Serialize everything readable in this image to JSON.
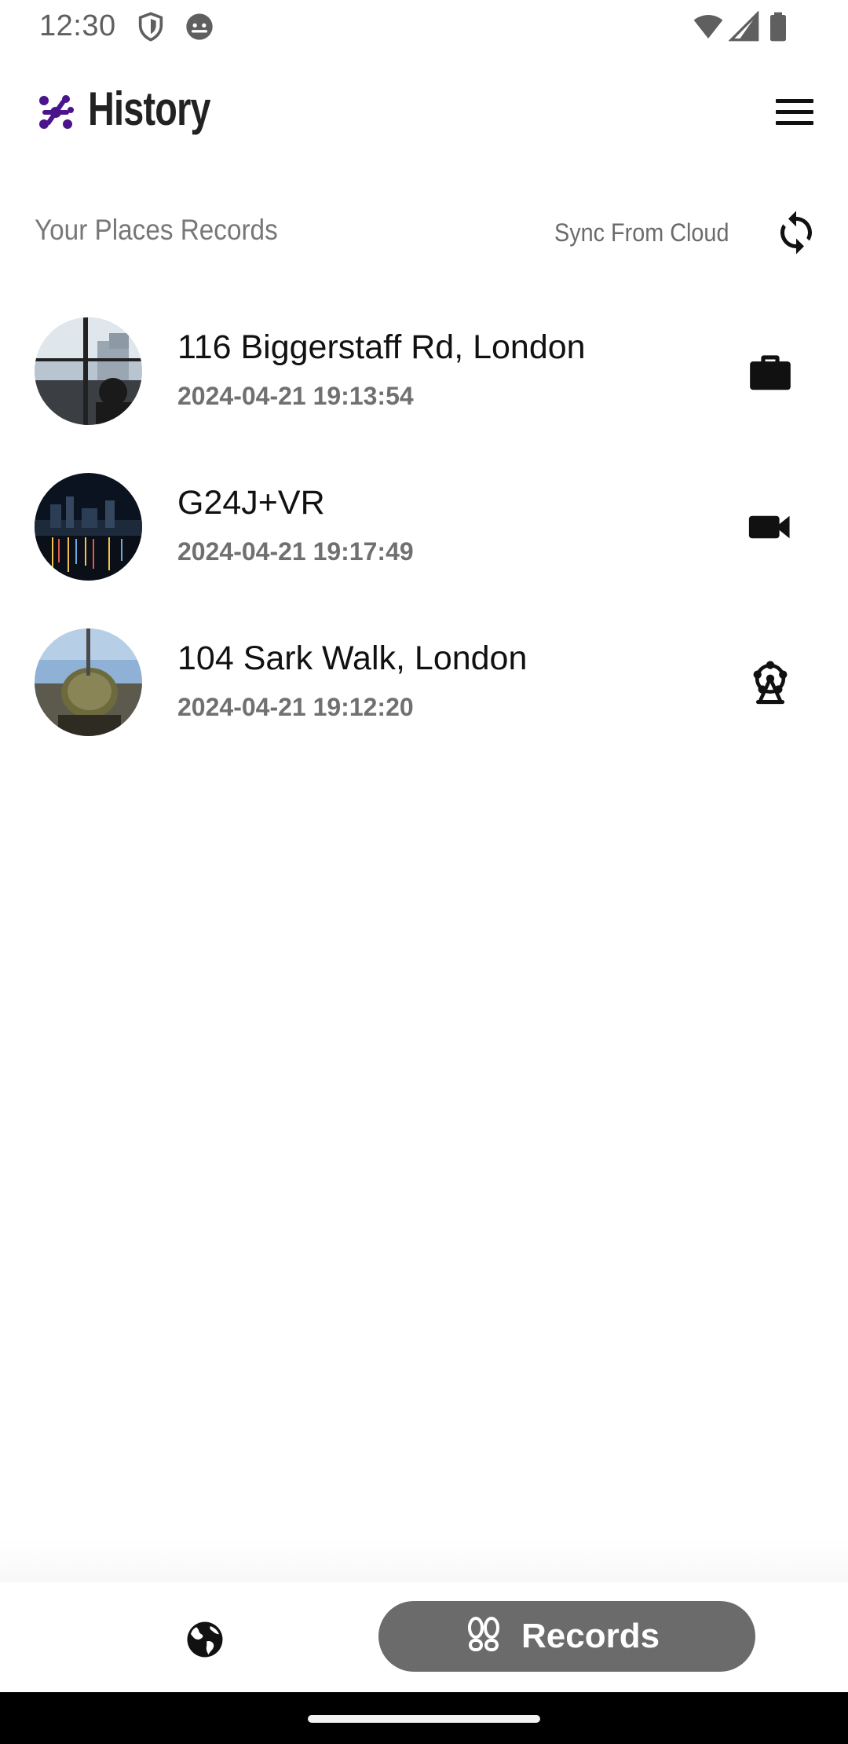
{
  "status_bar": {
    "time": "12:30",
    "left_icons": [
      "shield-icon",
      "android-icon"
    ],
    "right_icons": [
      "wifi-icon",
      "signal-icon",
      "battery-icon"
    ]
  },
  "app_bar": {
    "title": "History",
    "logo": "app-logo-icon",
    "menu_icon": "hamburger-menu-icon",
    "logo_color": "#4a148c"
  },
  "section": {
    "title": "Your Places Records",
    "sync_label": "Sync From Cloud",
    "sync_icon": "sync-icon"
  },
  "records": [
    {
      "title": "116 Biggerstaff Rd, London",
      "time": "2024-04-21 19:13:54",
      "category_icon": "briefcase-icon",
      "thumbnail": "office-window-photo"
    },
    {
      "title": "G24J+VR",
      "time": "2024-04-21 19:17:49",
      "category_icon": "videocam-icon",
      "thumbnail": "night-city-waterfront-photo"
    },
    {
      "title": "104 Sark Walk, London",
      "time": "2024-04-21 19:12:20",
      "category_icon": "ferris-wheel-icon",
      "thumbnail": "cactus-plant-photo"
    }
  ],
  "bottom_nav": {
    "globe_icon": "globe-icon",
    "records_label": "Records",
    "records_icon": "footprints-icon",
    "active_color": "#6b6b6b"
  }
}
